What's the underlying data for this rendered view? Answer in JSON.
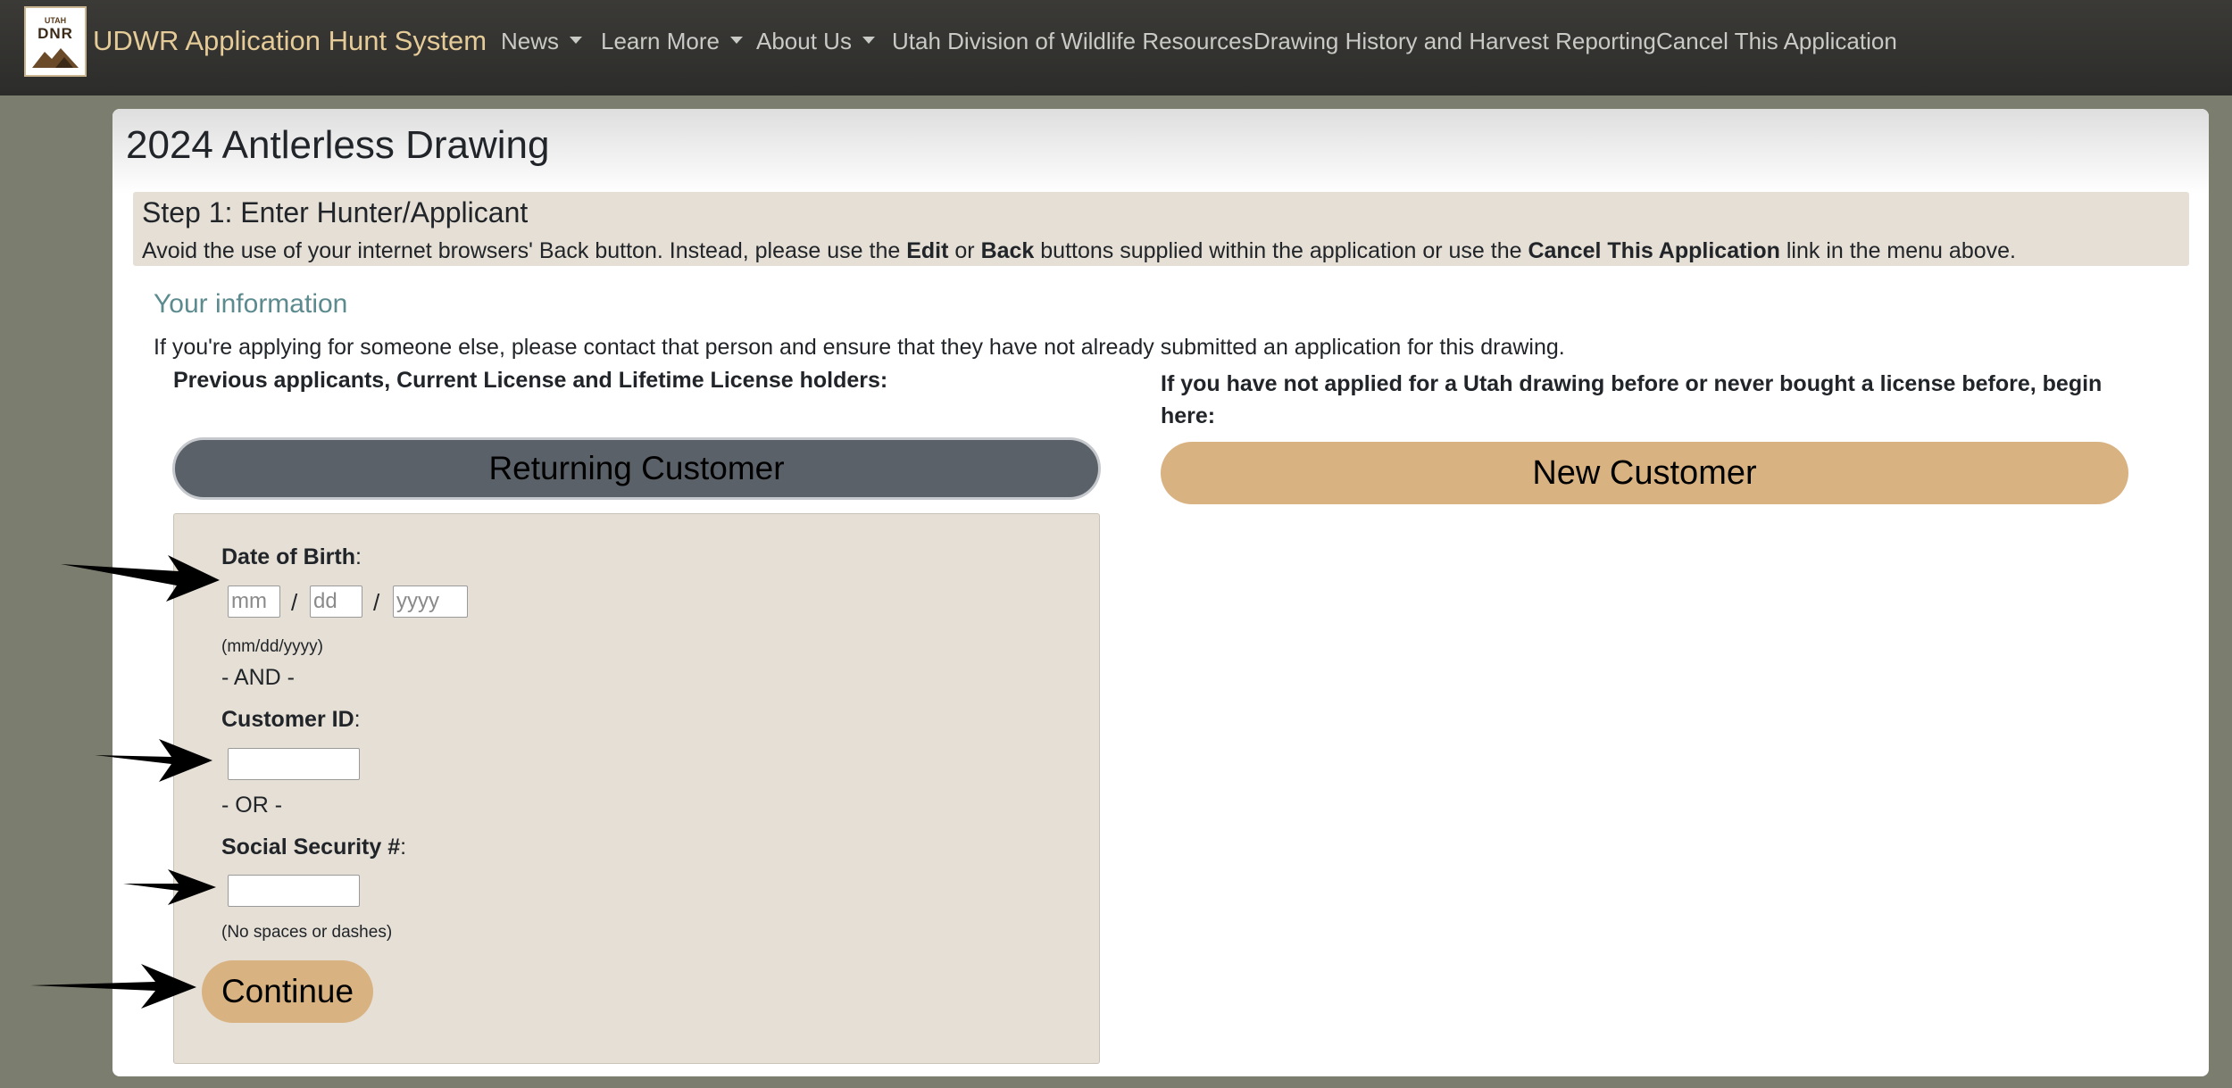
{
  "navbar": {
    "logo_text": "DNR",
    "logo_sub": "UTAH",
    "brand": "UDWR Application Hunt System",
    "items": [
      {
        "label": "News"
      },
      {
        "label": "Learn More"
      },
      {
        "label": "About Us"
      },
      {
        "label": "Utah Division of Wildlife Resources"
      },
      {
        "label": "Drawing History and Harvest Reporting"
      },
      {
        "label": "Cancel This Application"
      }
    ]
  },
  "page": {
    "title": "2024 Antlerless Drawing",
    "step_title": "Step 1: Enter Hunter/Applicant",
    "step_text": {
      "t1": "Avoid the use of your internet browsers' Back button. Instead, please use the ",
      "edit": "Edit",
      "t2": " or ",
      "back": "Back",
      "t3": " buttons supplied within the application or use the ",
      "cancel": "Cancel This Application",
      "t4": " link in the menu above."
    },
    "section_title": "Your information",
    "section_text": "If you're applying for someone else, please contact that person and ensure that they have not already submitted an application for this drawing.",
    "returning_heading": "Previous applicants, Current License and Lifetime License holders:",
    "new_heading": "If you have not applied for a Utah drawing before or never bought a license before, begin here:",
    "returning_button": "Returning Customer",
    "new_button": "New Customer"
  },
  "form": {
    "dob_label": "Date of Birth",
    "colon": ":",
    "mm_placeholder": "mm",
    "dd_placeholder": "dd",
    "yyyy_placeholder": "yyyy",
    "slash": "/",
    "dob_hint": "(mm/dd/yyyy)",
    "and_sep": "- AND -",
    "customer_id_label": "Customer ID",
    "customer_id_value": "",
    "or_sep": "- OR -",
    "ssn_label": "Social Security #",
    "ssn_value": "",
    "ssn_hint": "(No spaces or dashes)",
    "continue_button": "Continue"
  },
  "colors": {
    "navbar_bg": "#2f2f2d",
    "brand": "#e5cb97",
    "accent_tan": "#d9b281",
    "panel_bg": "#e5dfd5",
    "returning_btn": "#5b6169",
    "section_title": "#5b8a8f"
  }
}
